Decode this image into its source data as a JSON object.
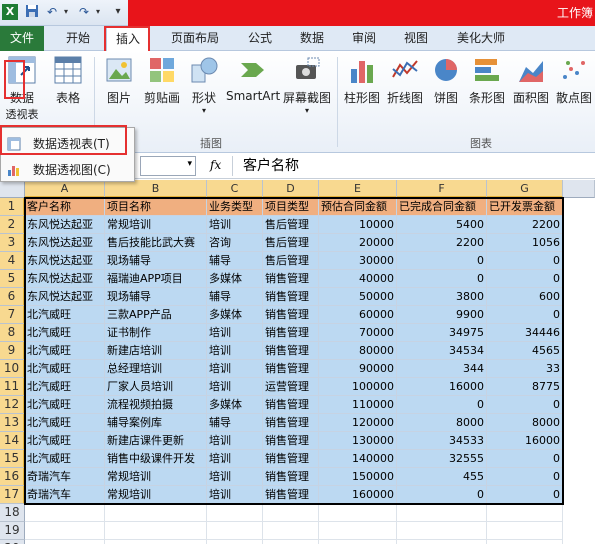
{
  "window": {
    "title": "工作簿"
  },
  "tabs": [
    "文件",
    "开始",
    "插入",
    "页面布局",
    "公式",
    "数据",
    "审阅",
    "视图",
    "美化大师"
  ],
  "ribbon": {
    "pivot_btn": {
      "label1": "数据",
      "label2": "透视表"
    },
    "table_btn": "表格",
    "picture_btn": "图片",
    "clipart_btn": "剪贴画",
    "shapes_btn": "形状",
    "smartart_btn": "SmartArt",
    "screenshot_btn": "屏幕截图",
    "illustrations_group": "插图",
    "column_chart": "柱形图",
    "line_chart": "折线图",
    "pie_chart": "饼图",
    "bar_chart": "条形图",
    "area_chart": "面积图",
    "scatter_chart": "散点图",
    "charts_group": "图表"
  },
  "dropdown": {
    "item1": "数据透视表(T)",
    "item2": "数据透视图(C)"
  },
  "formula_bar": {
    "fx": "fx",
    "value": "客户名称"
  },
  "columns": [
    "A",
    "B",
    "C",
    "D",
    "E",
    "F",
    "G"
  ],
  "sheet": {
    "headers": [
      "客户名称",
      "项目名称",
      "业务类型",
      "项目类型",
      "预估合同金额",
      "已完成合同金额",
      "已开发票金额"
    ],
    "rows": [
      [
        "东风悦达起亚",
        "常规培训",
        "培训",
        "售后管理",
        "10000",
        "5400",
        "2200"
      ],
      [
        "东风悦达起亚",
        "售后技能比武大赛",
        "咨询",
        "售后管理",
        "20000",
        "2200",
        "1056"
      ],
      [
        "东风悦达起亚",
        "现场辅导",
        "辅导",
        "售后管理",
        "30000",
        "0",
        "0"
      ],
      [
        "东风悦达起亚",
        "福瑞迪APP项目",
        "多媒体",
        "销售管理",
        "40000",
        "0",
        "0"
      ],
      [
        "东风悦达起亚",
        "现场辅导",
        "辅导",
        "销售管理",
        "50000",
        "3800",
        "600"
      ],
      [
        "北汽威旺",
        "三款APP产品",
        "多媒体",
        "销售管理",
        "60000",
        "9900",
        "0"
      ],
      [
        "北汽威旺",
        "证书制作",
        "培训",
        "销售管理",
        "70000",
        "34975",
        "34446"
      ],
      [
        "北汽威旺",
        "新建店培训",
        "培训",
        "销售管理",
        "80000",
        "34534",
        "4565"
      ],
      [
        "北汽威旺",
        "总经理培训",
        "培训",
        "销售管理",
        "90000",
        "344",
        "33"
      ],
      [
        "北汽威旺",
        "厂家人员培训",
        "培训",
        "运营管理",
        "100000",
        "16000",
        "8775"
      ],
      [
        "北汽威旺",
        "流程视频拍摄",
        "多媒体",
        "销售管理",
        "110000",
        "0",
        "0"
      ],
      [
        "北汽威旺",
        "辅导案例库",
        "辅导",
        "销售管理",
        "120000",
        "8000",
        "8000"
      ],
      [
        "北汽威旺",
        "新建店课件更新",
        "培训",
        "销售管理",
        "130000",
        "34533",
        "16000"
      ],
      [
        "北汽威旺",
        "销售中级课件开发",
        "培训",
        "销售管理",
        "140000",
        "32555",
        "0"
      ],
      [
        "奇瑞汽车",
        "常规培训",
        "培训",
        "销售管理",
        "150000",
        "455",
        "0"
      ],
      [
        "奇瑞汽车",
        "常规培训",
        "培训",
        "销售管理",
        "160000",
        "0",
        "0"
      ]
    ],
    "row_numbers": [
      "1",
      "2",
      "3",
      "4",
      "5",
      "6",
      "7",
      "8",
      "9",
      "10",
      "11",
      "12",
      "13",
      "14",
      "15",
      "16",
      "17",
      "18",
      "19",
      "20"
    ]
  }
}
